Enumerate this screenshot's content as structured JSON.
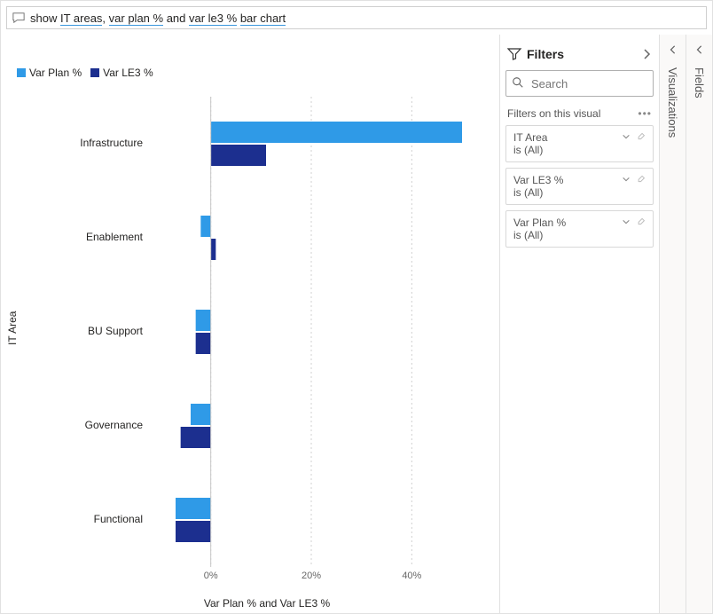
{
  "query": {
    "prefix": "show ",
    "p1": "IT areas",
    "sep1": ", ",
    "p2": "var plan %",
    "sep2": " and ",
    "p3": "var le3 %",
    "sep3": " ",
    "p4": "bar chart"
  },
  "legend": {
    "series1": "Var Plan %",
    "series2": "Var LE3 %",
    "color1": "#2f9ae7",
    "color2": "#1c2f8f"
  },
  "axis": {
    "yLabel": "IT Area",
    "xLabel": "Var Plan % and Var LE3 %",
    "ticks": [
      "0%",
      "20%",
      "40%"
    ]
  },
  "filters": {
    "title": "Filters",
    "searchPlaceholder": "Search",
    "sectionTitle": "Filters on this visual",
    "is": "is (All)",
    "items": [
      {
        "name": "IT Area"
      },
      {
        "name": "Var LE3 %"
      },
      {
        "name": "Var Plan %"
      }
    ]
  },
  "rails": {
    "viz": "Visualizations",
    "fields": "Fields"
  },
  "chart_data": {
    "type": "bar",
    "orientation": "horizontal",
    "title": "",
    "xlabel": "Var Plan % and Var LE3 %",
    "ylabel": "IT Area",
    "xlim": [
      -10,
      50
    ],
    "categories": [
      "Infrastructure",
      "Enablement",
      "BU Support",
      "Governance",
      "Functional"
    ],
    "series": [
      {
        "name": "Var Plan %",
        "color": "#2f9ae7",
        "values": [
          50,
          -2,
          -3,
          -4,
          -7
        ]
      },
      {
        "name": "Var LE3 %",
        "color": "#1c2f8f",
        "values": [
          11,
          1,
          -3,
          -6,
          -7
        ]
      }
    ],
    "grid": true,
    "legend_position": "top-left"
  }
}
